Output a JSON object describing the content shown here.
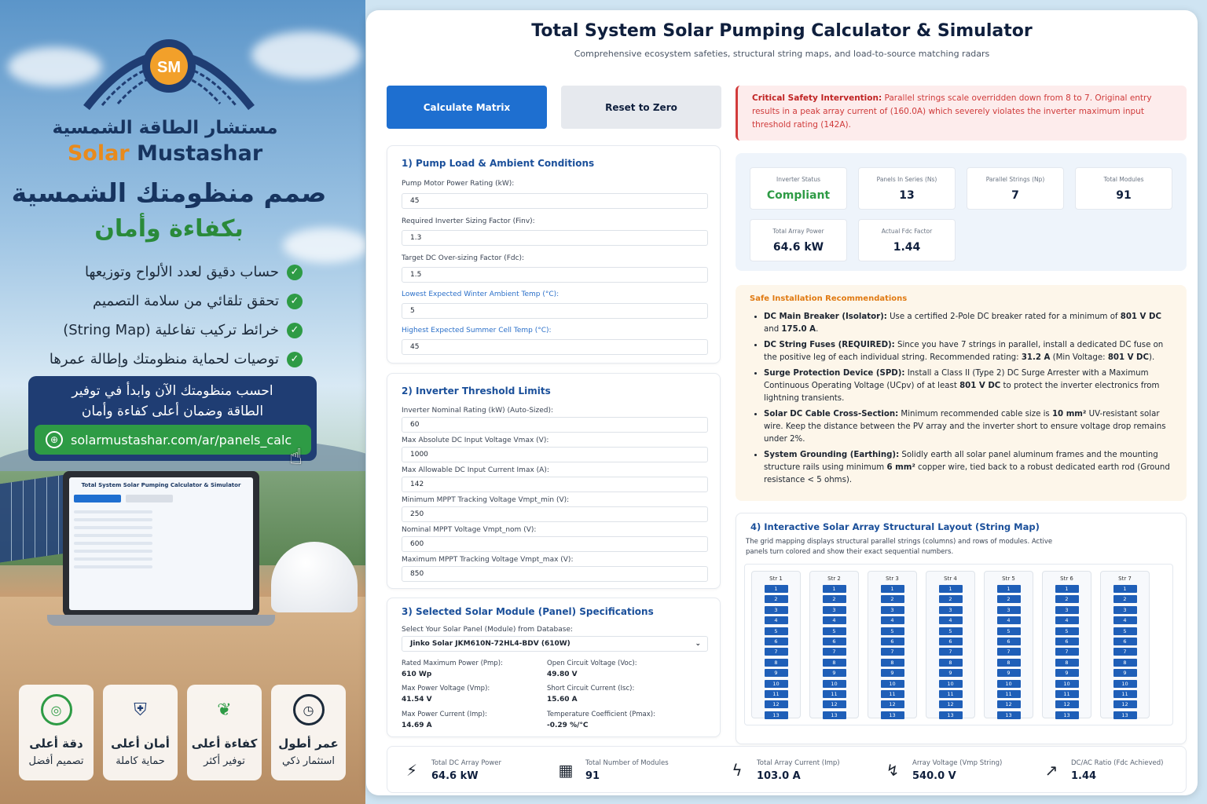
{
  "promo": {
    "brand_ar": "مستشار الطاقة الشمسية",
    "brand_en_a": "Solar",
    "brand_en_b": "Mustashar",
    "logo_initials": "SM",
    "headline1": "صمم منظومتك الشمسية",
    "headline2": "بكفاءة وأمان",
    "features": [
      "حساب دقيق لعدد الألواح وتوزيعها",
      "تحقق تلقائي من سلامة التصميم",
      "خرائط تركيب تفاعلية (String Map)",
      "توصيات لحماية منظومتك وإطالة عمرها"
    ],
    "cta_line1": "احسب منظومتك الآن وابدأ في توفير",
    "cta_line2": "الطاقة وضمان أعلى كفاءة وأمان",
    "cta_url": "solarmustashar.com/ar/panels_calc",
    "badges": [
      {
        "icon": "clock-icon",
        "l1": "عمر أطول",
        "l2": "استثمار ذكي",
        "color": "#1c2a3a"
      },
      {
        "icon": "leaf-icon",
        "l1": "كفاءة أعلى",
        "l2": "توفير أكثر",
        "color": "#2e9b45"
      },
      {
        "icon": "shield-check-icon",
        "l1": "أمان أعلى",
        "l2": "حماية كاملة",
        "color": "#1f3d73"
      },
      {
        "icon": "target-icon",
        "l1": "دقة أعلى",
        "l2": "تصميم أفضل",
        "color": "#2e9b45"
      }
    ]
  },
  "app": {
    "title": "Total System Solar Pumping Calculator & Simulator",
    "subtitle": "Comprehensive ecosystem safeties, structural string maps, and load-to-source matching radars",
    "calc_label": "Calculate Matrix",
    "reset_label": "Reset to Zero"
  },
  "section1": {
    "title": "1) Pump Load & Ambient Conditions",
    "fields": [
      {
        "label": "Pump Motor Power Rating (kW):",
        "value": "45"
      },
      {
        "label": "Required Inverter Sizing Factor (Finv):",
        "value": "1.3"
      },
      {
        "label": "Target DC Over-sizing Factor (Fdc):",
        "value": "1.5"
      },
      {
        "label": "Lowest Expected Winter Ambient Temp (°C):",
        "value": "5"
      },
      {
        "label": "Highest Expected Summer Cell Temp (°C):",
        "value": "45"
      }
    ]
  },
  "section2": {
    "title": "2) Inverter Threshold Limits",
    "fields": [
      {
        "label": "Inverter Nominal Rating (kW) (Auto-Sized):",
        "value": "60"
      },
      {
        "label": "Max Absolute DC Input Voltage Vmax (V):",
        "value": "1000"
      },
      {
        "label": "Max Allowable DC Input Current Imax (A):",
        "value": "142"
      },
      {
        "label": "Minimum MPPT Tracking Voltage Vmpt_min (V):",
        "value": "250"
      },
      {
        "label": "Nominal MPPT Voltage Vmpt_nom (V):",
        "value": "600"
      },
      {
        "label": "Maximum MPPT Tracking Voltage Vmpt_max (V):",
        "value": "850"
      }
    ]
  },
  "section3": {
    "title": "3) Selected Solar Module (Panel) Specifications",
    "select_label": "Select Your Solar Panel (Module) from Database:",
    "select_value": "Jinko Solar JKM610N-72HL4-BDV (610W)",
    "specs": [
      {
        "k": "Rated Maximum Power (Pmp):",
        "v": "610 Wp"
      },
      {
        "k": "Open Circuit Voltage (Voc):",
        "v": "49.80 V"
      },
      {
        "k": "Max Power Voltage (Vmp):",
        "v": "41.54 V"
      },
      {
        "k": "Short Circuit Current (Isc):",
        "v": "15.60 A"
      },
      {
        "k": "Max Power Current (Imp):",
        "v": "14.69 A"
      },
      {
        "k": "Temperature Coefficient (Pmax):",
        "v": "-0.29 %/°C"
      }
    ]
  },
  "alert": {
    "bold": "Critical Safety Intervention:",
    "text": " Parallel strings scale overridden down from 8 to 7. Original entry results in a peak array current of (160.0A) which severely violates the inverter maximum input threshold rating (142A)."
  },
  "status": [
    {
      "k": "Inverter Status",
      "v": "Compliant"
    },
    {
      "k": "Panels In Series (Ns)",
      "v": "13"
    },
    {
      "k": "Parallel Strings (Np)",
      "v": "7"
    },
    {
      "k": "Total Modules",
      "v": "91"
    },
    {
      "k": "Total Array Power",
      "v": "64.6 kW"
    },
    {
      "k": "Actual Fdc Factor",
      "v": "1.44"
    }
  ],
  "recommendations": {
    "title": "Safe Installation Recommendations",
    "items": [
      {
        "b": "DC Main Breaker (Isolator):",
        "t1": " Use a certified 2-Pole DC breaker rated for a minimum of ",
        "b2": "801 V DC",
        "t2": " and ",
        "b3": "175.0 A",
        "t3": "."
      },
      {
        "b": "DC String Fuses (REQUIRED):",
        "t1": " Since you have 7 strings in parallel, install a dedicated DC fuse on the positive leg of each individual string. Recommended rating: ",
        "b2": "31.2 A",
        "t2": " (Min Voltage: ",
        "b3": "801 V DC",
        "t3": ")."
      },
      {
        "b": "Surge Protection Device (SPD):",
        "t1": " Install a Class II (Type 2) DC Surge Arrester with a Maximum Continuous Operating Voltage (UCpv) of at least ",
        "b2": "801 V DC",
        "t2": " to protect the inverter electronics from lightning transients.",
        "b3": "",
        "t3": ""
      },
      {
        "b": "Solar DC Cable Cross-Section:",
        "t1": " Minimum recommended cable size is ",
        "b2": "10 mm²",
        "t2": " UV-resistant solar wire. Keep the distance between the PV array and the inverter short to ensure voltage drop remains under 2%.",
        "b3": "",
        "t3": ""
      },
      {
        "b": "System Grounding (Earthing):",
        "t1": " Solidly earth all solar panel aluminum frames and the mounting structure rails using minimum ",
        "b2": "6 mm²",
        "t2": " copper wire, tied back to a robust dedicated earth rod (Ground resistance < 5 ohms).",
        "b3": "",
        "t3": ""
      }
    ]
  },
  "string_map": {
    "title": "4) Interactive Solar Array Structural Layout (String Map)",
    "desc": "The grid mapping displays structural parallel strings (columns) and rows of modules. Active panels turn colored and show their exact sequential numbers.",
    "strings": [
      "Str 1",
      "Str 2",
      "Str 3",
      "Str 4",
      "Str 5",
      "Str 6",
      "Str 7"
    ],
    "modules": [
      "1",
      "2",
      "3",
      "4",
      "5",
      "6",
      "7",
      "8",
      "9",
      "10",
      "11",
      "12",
      "13"
    ],
    "module_color": "#1f5fb8"
  },
  "footer": [
    {
      "icon": "bolt-icon",
      "k": "Total DC Array Power",
      "v": "64.6 kW"
    },
    {
      "icon": "grid-icon",
      "k": "Total Number of Modules",
      "v": "91"
    },
    {
      "icon": "current-icon",
      "k": "Total Array Current (Imp)",
      "v": "103.0 A"
    },
    {
      "icon": "voltage-icon",
      "k": "Array Voltage (Vmp String)",
      "v": "540.0 V"
    },
    {
      "icon": "trend-icon",
      "k": "DC/AC Ratio (Fdc Achieved)",
      "v": "1.44"
    }
  ],
  "colors": {
    "primary": "#1e6fd0",
    "success": "#2e9b45",
    "danger": "#d23b3b",
    "warning": "#e07a12"
  }
}
